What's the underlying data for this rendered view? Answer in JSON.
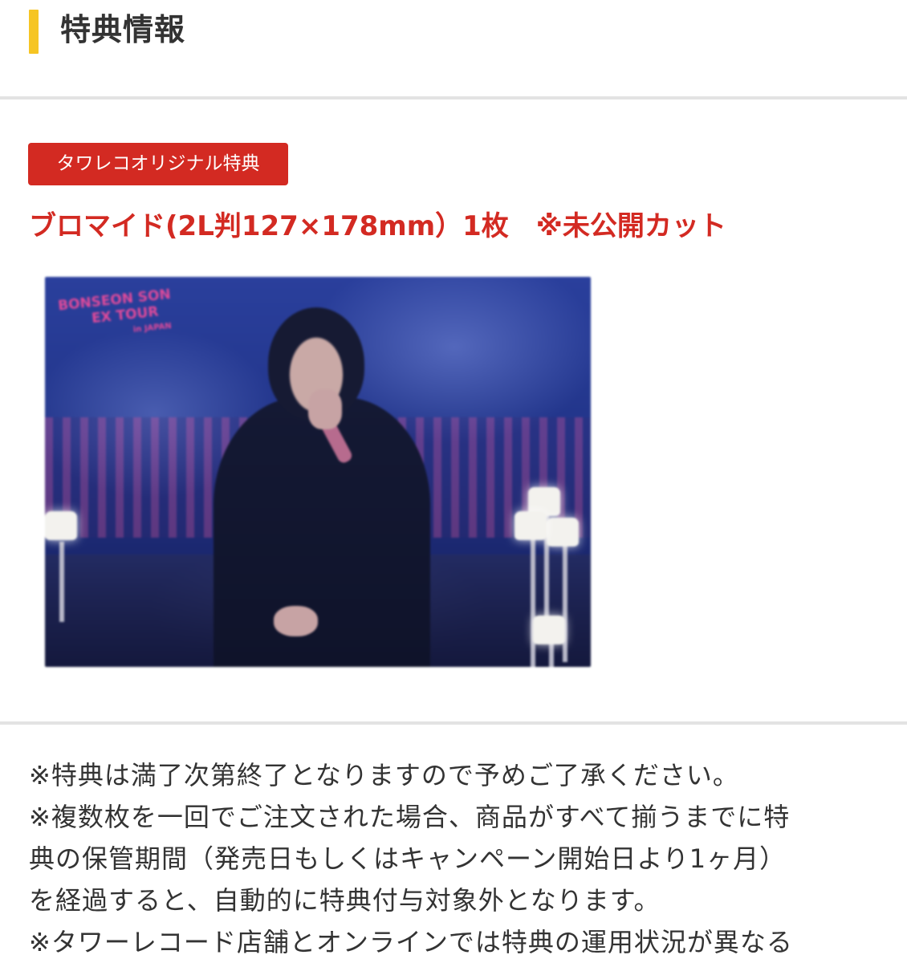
{
  "section": {
    "title": "特典情報",
    "accent_color": "#f6c523"
  },
  "badge": {
    "label": "タワレコオリジナル特典",
    "color": "#d32a22"
  },
  "product": {
    "title": "ブロマイド(2L判127×178mm）1枚　※未公開カット"
  },
  "image": {
    "logo_text": [
      "BONSEON SON",
      "EX TOUR",
      "in JAPAN"
    ]
  },
  "notes": [
    "※特典は満了次第終了となりますので予めご了承ください。",
    "※複数枚を一回でご注文された場合、商品がすべて揃うまでに特",
    "典の保管期間（発売日もしくはキャンペーン開始日より1ヶ月）",
    "を経過すると、自動的に特典付与対象外となります。",
    "※タワーレコード店舗とオンラインでは特典の運用状況が異なる"
  ]
}
